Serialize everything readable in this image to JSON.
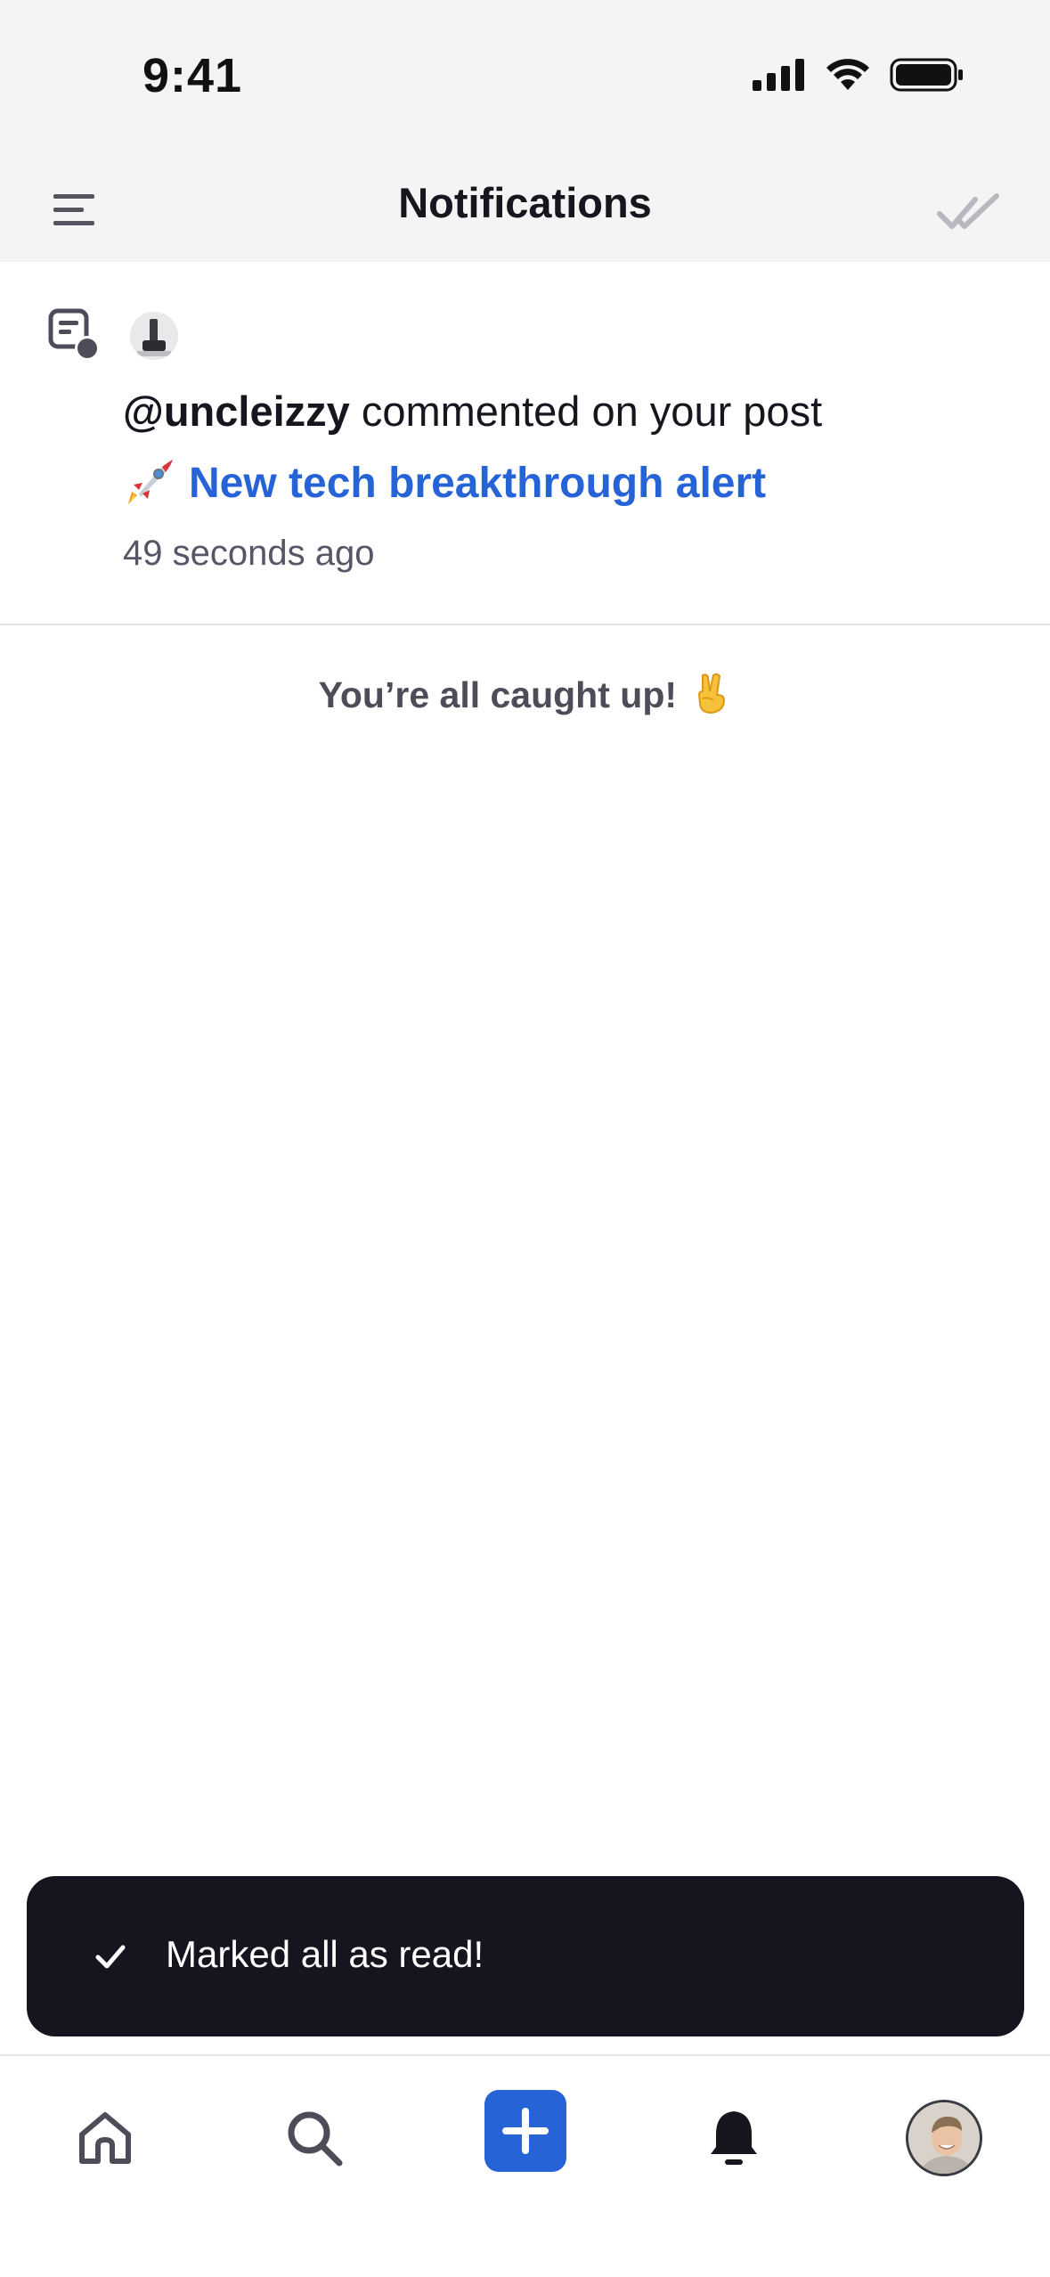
{
  "status_bar": {
    "time": "9:41"
  },
  "header": {
    "title": "Notifications"
  },
  "notifications": [
    {
      "type_icon": "comment-icon",
      "username": "@uncleizzy",
      "action": " commented on your post",
      "post_emoji": "rocket-emoji",
      "post_title": "New tech breakthrough alert",
      "time_ago": "49 seconds ago"
    }
  ],
  "empty_state": {
    "message": "You’re all caught up!",
    "emoji": "victory-hand-emoji"
  },
  "toast": {
    "message": "Marked all as read!"
  },
  "tab_bar": {
    "items": [
      "home-icon",
      "search-icon",
      "add-icon",
      "bell-icon",
      "profile-avatar"
    ]
  },
  "colors": {
    "accent": "#2563d6",
    "toast_bg": "#15151f",
    "header_bg": "#f4f4f4",
    "text": "#16161e",
    "muted": "#565666"
  }
}
